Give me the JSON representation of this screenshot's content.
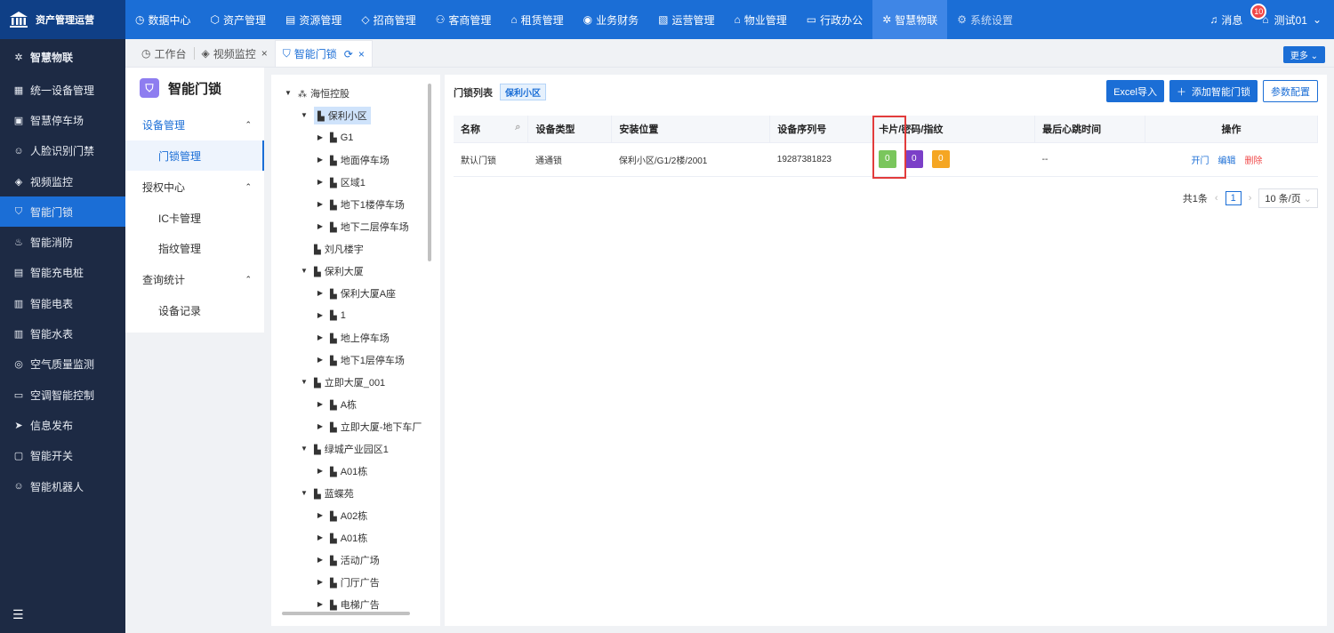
{
  "app": {
    "title": "资产管理运营",
    "logo_icon": "building-icon"
  },
  "nav": [
    {
      "label": "数据中心",
      "icon": "◷",
      "active": false
    },
    {
      "label": "资产管理",
      "icon": "⬡",
      "active": false
    },
    {
      "label": "资源管理",
      "icon": "▤",
      "active": false
    },
    {
      "label": "招商管理",
      "icon": "◇",
      "active": false
    },
    {
      "label": "客商管理",
      "icon": "⚇",
      "active": false
    },
    {
      "label": "租赁管理",
      "icon": "⌂",
      "active": false
    },
    {
      "label": "业务财务",
      "icon": "◉",
      "active": false
    },
    {
      "label": "运营管理",
      "icon": "▧",
      "active": false
    },
    {
      "label": "物业管理",
      "icon": "⌂",
      "active": false
    },
    {
      "label": "行政办公",
      "icon": "▭",
      "active": false
    },
    {
      "label": "智慧物联",
      "icon": "✲",
      "active": true
    },
    {
      "label": "系统设置",
      "icon": "⚙",
      "active": false,
      "dim": true
    }
  ],
  "header": {
    "message_label": "消息",
    "message_count": "10",
    "user_name": "测试01"
  },
  "sidebar": {
    "title": "智慧物联",
    "items": [
      {
        "label": "统一设备管理",
        "icon": "▦"
      },
      {
        "label": "智慧停车场",
        "icon": "▣"
      },
      {
        "label": "人脸识别门禁",
        "icon": "☺"
      },
      {
        "label": "视频监控",
        "icon": "◈"
      },
      {
        "label": "智能门锁",
        "icon": "⛉",
        "active": true
      },
      {
        "label": "智能消防",
        "icon": "♨"
      },
      {
        "label": "智能充电桩",
        "icon": "▤"
      },
      {
        "label": "智能电表",
        "icon": "▥"
      },
      {
        "label": "智能水表",
        "icon": "▥"
      },
      {
        "label": "空气质量监测",
        "icon": "◎"
      },
      {
        "label": "空调智能控制",
        "icon": "▭"
      },
      {
        "label": "信息发布",
        "icon": "➤"
      },
      {
        "label": "智能开关",
        "icon": "▢"
      },
      {
        "label": "智能机器人",
        "icon": "☺"
      }
    ]
  },
  "tabs": [
    {
      "label": "工作台",
      "icon": "◷",
      "closable": false,
      "active": false
    },
    {
      "label": "视频监控",
      "icon": "◈",
      "closable": true,
      "active": false
    },
    {
      "label": "智能门锁",
      "icon": "⛉",
      "closable": true,
      "active": true
    }
  ],
  "more_label": "更多",
  "subnav": {
    "title": "智能门锁",
    "groups": [
      {
        "label": "设备管理",
        "active": true,
        "children": [
          {
            "label": "门锁管理",
            "active": true
          }
        ]
      },
      {
        "label": "授权中心",
        "active": false,
        "children": [
          {
            "label": "IC卡管理",
            "active": false
          },
          {
            "label": "指纹管理",
            "active": false
          }
        ]
      },
      {
        "label": "查询统计",
        "active": false,
        "children": [
          {
            "label": "设备记录",
            "active": false
          }
        ]
      }
    ]
  },
  "tree": [
    {
      "label": "海恒控股",
      "level": 0,
      "arrow": "▼",
      "icon": "⁂"
    },
    {
      "label": "保利小区",
      "level": 1,
      "arrow": "▼",
      "icon": "▙",
      "selected": true
    },
    {
      "label": "G1",
      "level": 2,
      "arrow": "▶",
      "icon": "▙"
    },
    {
      "label": "地面停车场",
      "level": 2,
      "arrow": "▶",
      "icon": "▙"
    },
    {
      "label": "区域1",
      "level": 2,
      "arrow": "▶",
      "icon": "▙"
    },
    {
      "label": "地下1楼停车场",
      "level": 2,
      "arrow": "▶",
      "icon": "▙"
    },
    {
      "label": "地下二层停车场",
      "level": 2,
      "arrow": "▶",
      "icon": "▙"
    },
    {
      "label": "刘凡楼宇",
      "level": 1,
      "arrow": "",
      "icon": "▙"
    },
    {
      "label": "保利大厦",
      "level": 1,
      "arrow": "▼",
      "icon": "▙"
    },
    {
      "label": "保利大厦A座",
      "level": 2,
      "arrow": "▶",
      "icon": "▙"
    },
    {
      "label": "1",
      "level": 2,
      "arrow": "▶",
      "icon": "▙"
    },
    {
      "label": "地上停车场",
      "level": 2,
      "arrow": "▶",
      "icon": "▙"
    },
    {
      "label": "地下1层停车场",
      "level": 2,
      "arrow": "▶",
      "icon": "▙"
    },
    {
      "label": "立即大厦_001",
      "level": 1,
      "arrow": "▼",
      "icon": "▙"
    },
    {
      "label": "A栋",
      "level": 2,
      "arrow": "▶",
      "icon": "▙"
    },
    {
      "label": "立即大厦-地下车厂",
      "level": 2,
      "arrow": "▶",
      "icon": "▙"
    },
    {
      "label": "绿城产业园区1",
      "level": 1,
      "arrow": "▼",
      "icon": "▙"
    },
    {
      "label": "A01栋",
      "level": 2,
      "arrow": "▶",
      "icon": "▙"
    },
    {
      "label": "蓝蝶苑",
      "level": 1,
      "arrow": "▼",
      "icon": "▙"
    },
    {
      "label": "A02栋",
      "level": 2,
      "arrow": "▶",
      "icon": "▙"
    },
    {
      "label": "A01栋",
      "level": 2,
      "arrow": "▶",
      "icon": "▙"
    },
    {
      "label": "活动广场",
      "level": 2,
      "arrow": "▶",
      "icon": "▙"
    },
    {
      "label": "门厅广告",
      "level": 2,
      "arrow": "▶",
      "icon": "▙"
    },
    {
      "label": "电梯广告",
      "level": 2,
      "arrow": "▶",
      "icon": "▙"
    }
  ],
  "main": {
    "list_title": "门锁列表",
    "filter_tag": "保利小区",
    "buttons": {
      "import": "Excel导入",
      "add": "添加智能门锁",
      "config": "参数配置"
    },
    "columns": [
      "名称",
      "设备类型",
      "安装位置",
      "设备序列号",
      "卡片/密码/指纹",
      "最后心跳时间",
      "操作"
    ],
    "rows": [
      {
        "name": "默认门锁",
        "type": "通通锁",
        "location": "保利小区/G1/2楼/2001",
        "serial": "19287381823",
        "card": "0",
        "password": "0",
        "fingerprint": "0",
        "heartbeat": "--",
        "actions": [
          "开门",
          "编辑",
          "删除"
        ]
      }
    ],
    "chip_colors": {
      "card": "#7ac65c",
      "password": "#7b3fc8",
      "fingerprint": "#f5a623"
    },
    "pager": {
      "total": "共1条",
      "page": "1",
      "page_size": "10 条/页"
    }
  }
}
